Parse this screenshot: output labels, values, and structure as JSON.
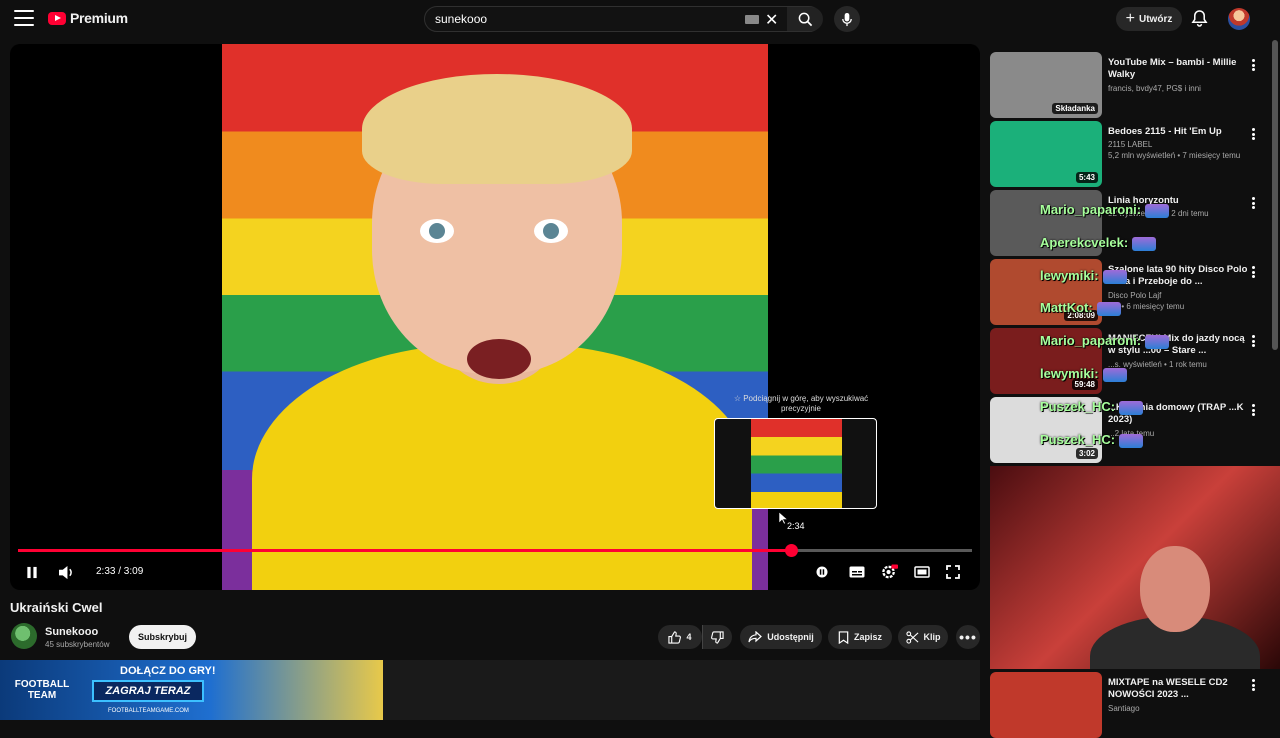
{
  "header": {
    "logo_text": "Premium",
    "search_value": "sunekooo",
    "create_label": "Utwórz"
  },
  "player": {
    "current_time": "2:33 / 3:09",
    "progress_fraction": 0.81,
    "hover_hint": "☆ Podciągnij w górę, aby wyszukiwać precyzyjnie",
    "hover_time": "2:34"
  },
  "video": {
    "title": "Ukraiński Cwel",
    "channel": "Sunekooo",
    "subscribers": "45 subskrybentów",
    "subscribe_label": "Subskrybuj",
    "likes": "4",
    "share_label": "Udostępnij",
    "save_label": "Zapisz",
    "clip_label": "Klip"
  },
  "ad": {
    "logo": "FOOTBALL TEAM",
    "headline": "DOŁĄCZ DO GRY!",
    "cta": "ZAGRAJ TERAZ",
    "url": "FOOTBALLTEAMGAME.COM"
  },
  "sidebar": [
    {
      "title": "YouTube Mix – bambi - Millie Walky",
      "channel": "francis, bvdy47, PG$ i inni",
      "meta": "",
      "badge": "Składanka",
      "thumb_color": "#8a8a8a"
    },
    {
      "title": "Bedoes 2115 - Hit 'Em Up",
      "channel": "2115 LABEL",
      "meta": "5,2 mln wyświetleń • 7 miesięcy temu",
      "badge": "5:43",
      "thumb_color": "#1bb07a"
    },
    {
      "title": "Linia horyzontu",
      "channel": "",
      "meta": "52 wyświetlenia • 2 dni temu",
      "badge": "",
      "thumb_color": "#5a5a5a"
    },
    {
      "title": "Szalone lata 90 hity Disco Polo ...uta i Przeboje do ...",
      "channel": "Disco Polo Lajf",
      "meta": "...ń • 6 miesięcy temu",
      "badge": "2:08:09",
      "thumb_color": "#b04a2f"
    },
    {
      "title": "MANIECZKI Mix do jazdy nocą w stylu ...00 – Stare ...",
      "channel": "",
      "meta": "...s. wyświetleń • 1 rok temu",
      "badge": "59:48",
      "thumb_color": "#7a1d1d"
    },
    {
      "title": "...Kuchnia domowy (TRAP ...K 2023)",
      "channel": "",
      "meta": "...2 lata temu",
      "badge": "3:02",
      "thumb_color": "#dcdcdc"
    },
    {
      "title": "MIXTAPE na WESELE CD2 NOWOŚCI 2023 ...",
      "channel": "Santiago",
      "meta": "",
      "badge": "",
      "thumb_color": "#c0392b"
    }
  ],
  "chat": [
    {
      "user": "Mario_paparoni:"
    },
    {
      "user": "Aperekcvelek:"
    },
    {
      "user": "lewymiki:"
    },
    {
      "user": "MattKot:"
    },
    {
      "user": "Mario_paparoni:"
    },
    {
      "user": "lewymiki:"
    },
    {
      "user": "Puszek_HC:"
    },
    {
      "user": "Puszek_HC:"
    }
  ],
  "colors": {
    "accent": "#ff0033",
    "chat_name": "#a7ff9c",
    "background": "#0f0f0f"
  },
  "icons": [
    "menu-icon",
    "youtube-logo-icon",
    "keyboard-icon",
    "clear-icon",
    "search-icon",
    "mic-icon",
    "plus-icon",
    "bell-icon",
    "pause-icon",
    "volume-icon",
    "autoplay-icon",
    "subtitles-icon",
    "settings-icon",
    "theater-icon",
    "fullscreen-icon",
    "like-icon",
    "dislike-icon",
    "share-icon",
    "save-icon",
    "clip-icon",
    "more-icon"
  ]
}
